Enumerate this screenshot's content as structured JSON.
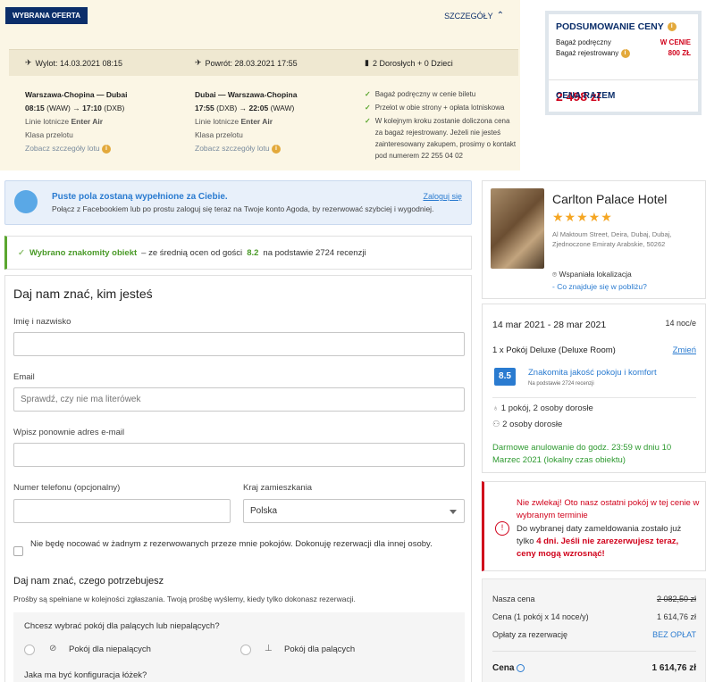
{
  "flight": {
    "tag": "WYBRANA OFERTA",
    "details_label": "SZCZEGÓŁY",
    "departure": "Wylot: 14.03.2021 08:15",
    "return": "Powrót: 28.03.2021 17:55",
    "passengers": "2 Dorosłych + 0 Dzieci",
    "outbound": {
      "route": "Warszawa-Chopina — Dubai",
      "dep_time": "08:15",
      "dep_code": "(WAW)",
      "arr_time": "17:10",
      "arr_code": "(DXB)",
      "airline_prefix": "Linie lotnicze",
      "airline": "Enter Air",
      "class": "Klasa przelotu",
      "details_link": "Zobacz szczegóły lotu"
    },
    "inbound": {
      "route": "Dubai — Warszawa-Chopina",
      "dep_time": "17:55",
      "dep_code": "(DXB)",
      "arr_time": "22:05",
      "arr_code": "(WAW)",
      "airline_prefix": "Linie lotnicze",
      "airline": "Enter Air",
      "class": "Klasa przelotu",
      "details_link": "Zobacz szczegóły lotu"
    },
    "checks": [
      "Bagaż podręczny w cenie biletu",
      "Przelot w obie strony + opłata lotniskowa",
      "W kolejnym kroku zostanie doliczona cena za bagaż rejestrowany. Jeżeli nie jesteś zainteresowany zakupem, prosimy o kontakt pod numerem 22 255 04 02"
    ]
  },
  "summary": {
    "title": "PODSUMOWANIE CENY",
    "hand_luggage_label": "Bagaż podręczny",
    "hand_luggage_value": "W CENIE",
    "checked_luggage_label": "Bagaż rejestrowany",
    "checked_luggage_value": "800 ZŁ",
    "total_label": "CENA RAZEM",
    "total_value": "2 498 zł"
  },
  "login": {
    "title": "Puste pola zostaną wypełnione za Ciebie.",
    "text": "Połącz z Facebookiem lub po prostu zaloguj się teraz na Twoje konto Agoda, by rezerwować szybciej i wygodniej.",
    "link": "Zaloguj się"
  },
  "good_banner": {
    "highlight": "Wybrano znakomity obiekt",
    "text_before": "– ze średnią ocen od gości",
    "score": "8.2",
    "text_after": "na podstawie 2724 recenzji"
  },
  "form": {
    "title": "Daj nam znać, kim jesteś",
    "name_label": "Imię i nazwisko",
    "name_value": "",
    "email_label": "Email",
    "email_placeholder": "Sprawdź, czy nie ma literówek",
    "email2_label": "Wpisz ponownie adres e-mail",
    "email2_value": "",
    "phone_label": "Numer telefonu (opcjonalny)",
    "phone_value": "",
    "country_label": "Kraj zamieszkania",
    "country_value": "Polska",
    "checkbox_text": "Nie będę nocować w żadnym z rezerwowanych przeze mnie pokojów. Dokonuję rezerwacji dla innej osoby.",
    "needs_title": "Daj nam znać, czego potrzebujesz",
    "needs_sub": "Prośby są spełniane w kolejności zgłaszania. Twoją prośbę wyślemy, kiedy tylko dokonasz rezerwacji.",
    "smoking_question": "Chcesz wybrać pokój dla palących lub niepalących?",
    "non_smoking": "Pokój dla niepalących",
    "smoking": "Pokój dla palących",
    "beds_question": "Jaka ma być konfiguracja łóżek?"
  },
  "hotel": {
    "name": "Carlton Palace Hotel",
    "stars": "★★★★★",
    "address": "Al Maktoum Street, Deira, Dubaj, Dubaj, Zjednoczone Emiraty Arabskie, 50262",
    "location": "Wspaniała lokalizacja",
    "nearby": "- Co znajduje się w pobliżu?"
  },
  "stay": {
    "dates": "14 mar 2021 - 28 mar 2021",
    "nights": "14 noc/e",
    "room": "1 x Pokój Deluxe (Deluxe Room)",
    "change": "Zmień",
    "score": "8.5",
    "quality": "Znakomita jakość pokoju i komfort",
    "reviews": "Na podstawie 2724 recenzji",
    "occupancy": "1 pokój, 2 osoby dorosłe",
    "adults": "2 osoby dorosłe",
    "cancellation": "Darmowe anulowanie do godz. 23:59 w dniu 10 Marzec 2021 (lokalny czas obiektu)"
  },
  "urgent": {
    "line1": "Nie zwlekaj! Oto nasz ostatni pokój w tej cenie w wybranym terminie",
    "line2_prefix": "Do wybranej daty zameldowania zostało już tylko",
    "days": "4 dni.",
    "warning": "Jeśli nie zarezerwujesz teraz, ceny mogą wzrosnąć!"
  },
  "price": {
    "our_price_label": "Nasza cena",
    "our_price_value": "2 082,50 zł",
    "price_label": "Cena (1 pokój x 14 noce/y)",
    "price_value": "1 614,76 zł",
    "fees_label": "Opłaty za rezerwację",
    "fees_value": "BEZ OPŁAT",
    "total_label": "Cena",
    "total_value": "1 614,76 zł"
  }
}
